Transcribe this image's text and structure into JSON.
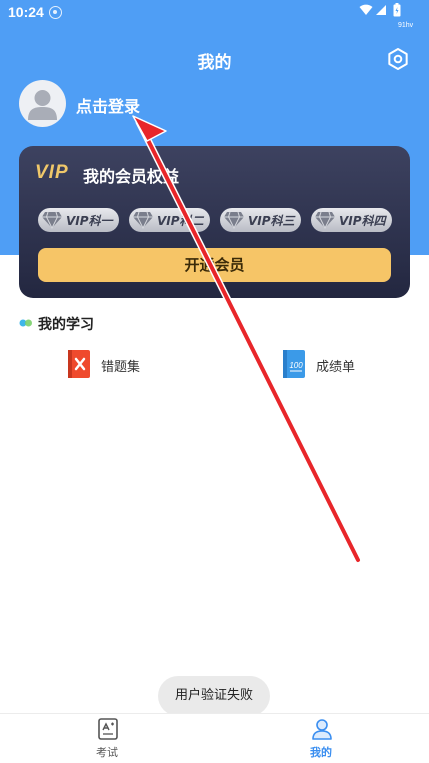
{
  "status_bar": {
    "time": "10:24",
    "badge": "91hv"
  },
  "header": {
    "title": "我的",
    "settings_icon": "gear-icon"
  },
  "profile": {
    "avatar_icon": "user-avatar-icon",
    "login_label": "点击登录"
  },
  "vip_card": {
    "logo": "VIP",
    "title": "我的会员权益",
    "tiers": [
      {
        "label": "VIP科一"
      },
      {
        "label": "VIP科二"
      },
      {
        "label": "VIP科三"
      },
      {
        "label": "VIP科四"
      }
    ],
    "open_button_label": "开通会员",
    "colors": {
      "card": "#2b2f4a",
      "accent": "#f6c567",
      "logo": "#f0c86a"
    }
  },
  "my_study": {
    "title": "我的学习",
    "items": [
      {
        "label": "错题集",
        "icon": "wrong-questions-icon"
      },
      {
        "label": "成绩单",
        "icon": "report-card-icon"
      }
    ]
  },
  "toast": {
    "message": "用户验证失败"
  },
  "tab_bar": {
    "tabs": [
      {
        "label": "考试",
        "icon": "exam-icon",
        "active": false
      },
      {
        "label": "我的",
        "icon": "profile-icon",
        "active": true
      }
    ],
    "active_color": "#3a8ef0"
  },
  "theme": {
    "header_blue": "#4f9ef5",
    "annotation_arrow": "#e8262a"
  }
}
